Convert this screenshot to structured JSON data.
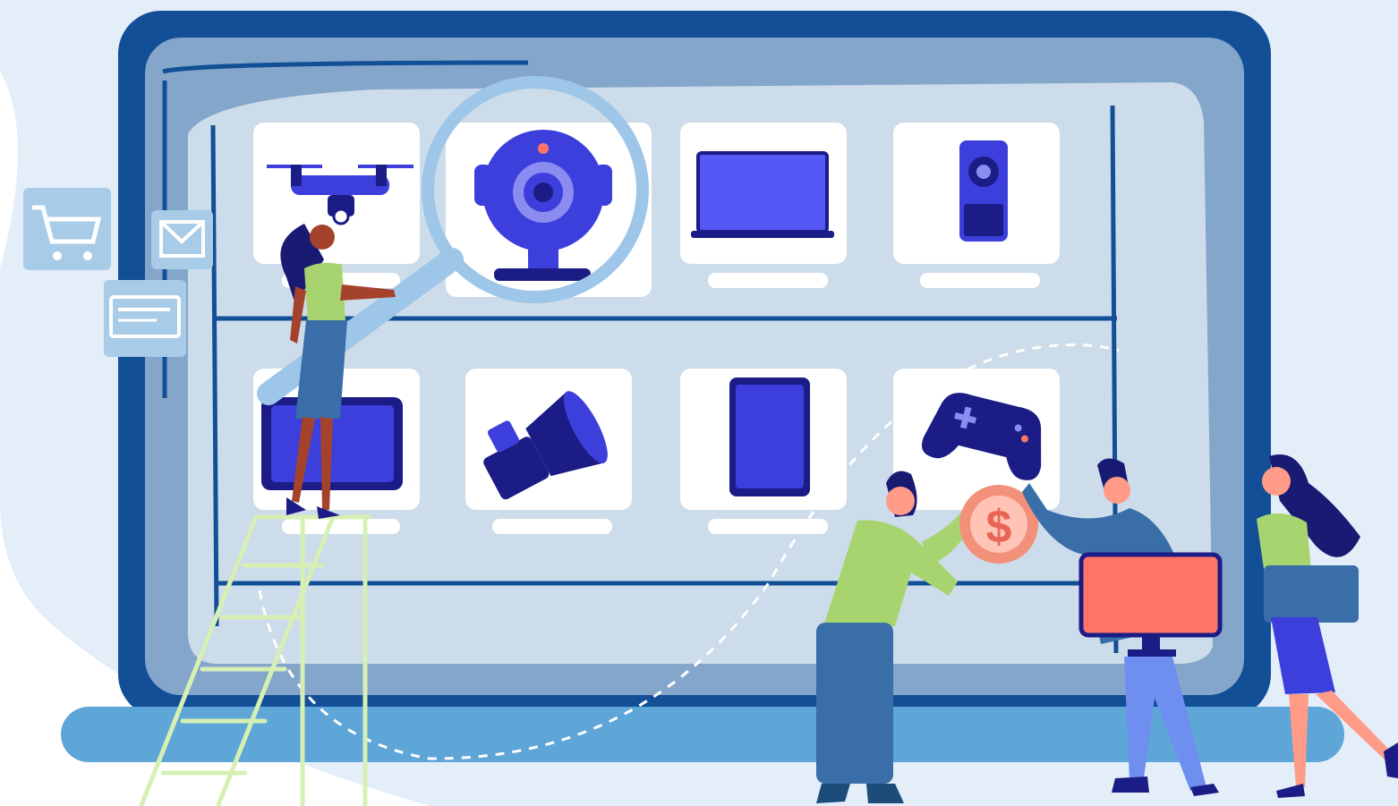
{
  "scene": {
    "kind": "flat vector illustration, electronics online store on a laptop screen",
    "colors": {
      "background_blob": "#e3eef9",
      "laptop_frame": "#124f96",
      "laptop_bezel": "#85a6cb",
      "screen": "#ccdcea",
      "shelf": "#124f96",
      "card": "#ffffff",
      "product": "#3c3fdc",
      "product_dark": "#1b1c85",
      "laptop_base": "#5ea5d8",
      "float_icon": "#a8cbe8",
      "ladder": "#d6f0b4",
      "magnifier_ring": "#9ec6e8",
      "coin": "#f3907a",
      "monitor": "#ff7565",
      "shirt_green": "#a8d46f",
      "pants": "#3a6ea8",
      "skin": "#a5422c",
      "hair": "#191b73"
    },
    "shelf_top": {
      "products": [
        "drone-icon",
        "webcam-icon",
        "laptop-icon",
        "remote-control-icon"
      ]
    },
    "shelf_bottom": {
      "products": [
        "tablet-landscape-icon",
        "camera-icon",
        "tablet-icon",
        "gamepad-icon"
      ]
    },
    "floating_icons": [
      "shopping-cart-icon",
      "envelope-icon",
      "credit-card-icon"
    ],
    "people": [
      "woman-on-ladder",
      "man-with-coin",
      "man-with-monitor",
      "woman-with-laptop"
    ],
    "coin_symbol": "$"
  }
}
